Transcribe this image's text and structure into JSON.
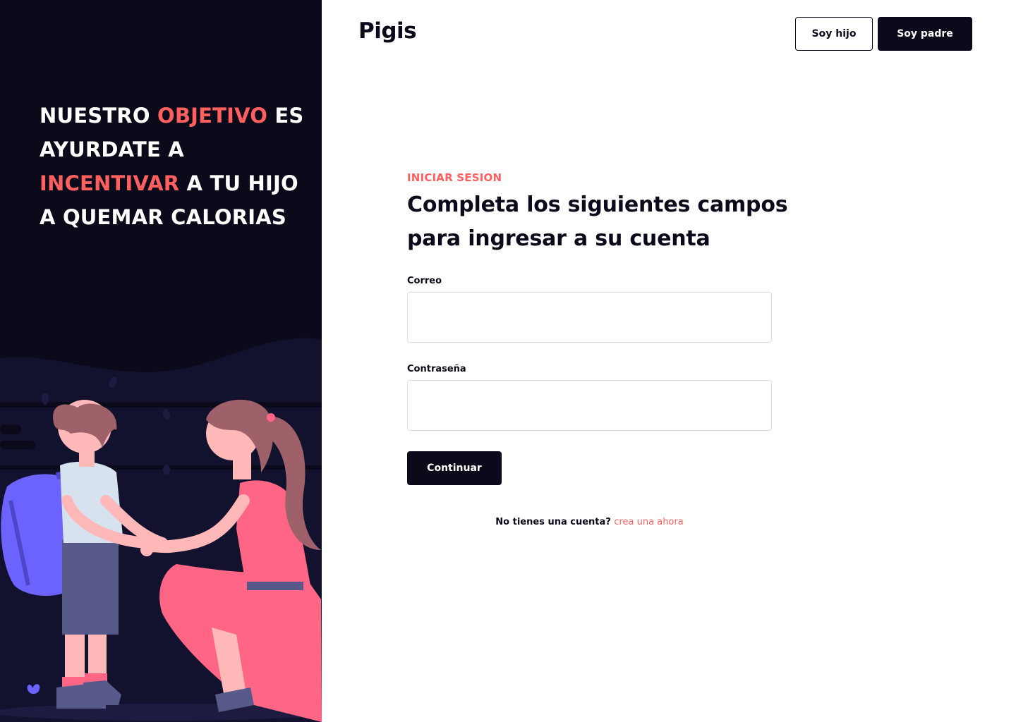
{
  "brand": {
    "logo": "Pigis"
  },
  "header": {
    "hijo_label": "Soy hijo",
    "padre_label": "Soy padre"
  },
  "hero": {
    "part1": "NUESTRO ",
    "accent1": "OBJETIVO",
    "part2": " ES AYURDATE A ",
    "accent2": "INCENTIVAR",
    "part3": " A TU HIJO A QUEMAR CALORIAS"
  },
  "login": {
    "eyebrow": "INICIAR SESION",
    "title": "Completa los siguientes campos para ingresar a su cuenta",
    "email_label": "Correo",
    "email_value": "",
    "password_label": "Contraseña",
    "password_value": "",
    "submit_label": "Continuar",
    "signup_prompt": "No tienes una cuenta?",
    "signup_link": "crea una ahora"
  },
  "colors": {
    "dark": "#0b0a1a",
    "accent": "#ff5f5f",
    "illustration_purple": "#6c63ff",
    "dress_pink": "#ff6584"
  }
}
